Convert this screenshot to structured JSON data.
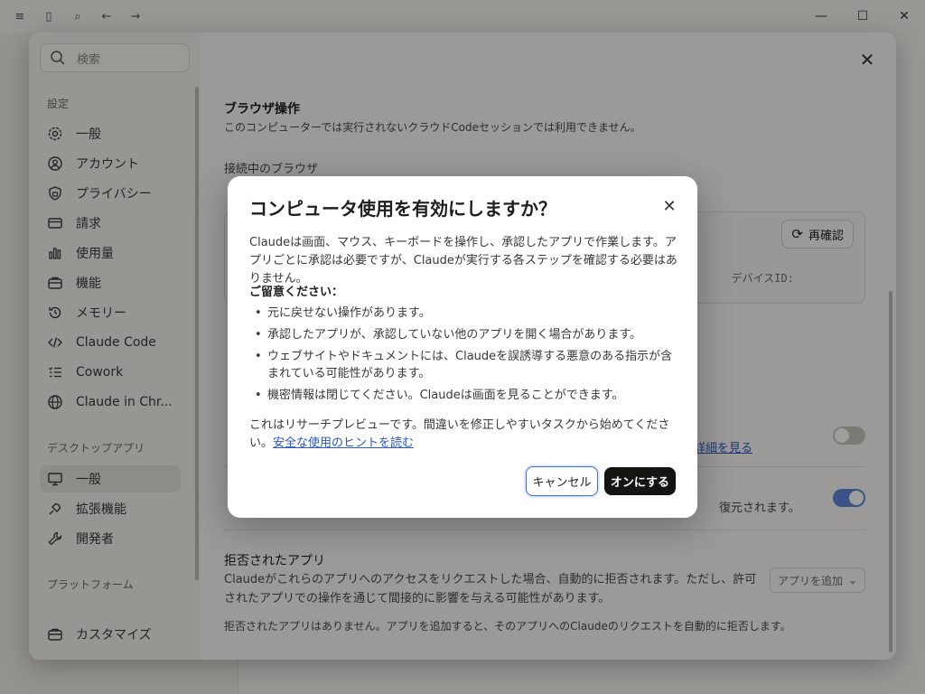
{
  "settings": {
    "search_placeholder": "検索",
    "nav_heading_settings": "設定",
    "nav_heading_desktop": "デスクトップアプリ",
    "nav_heading_platform": "プラットフォーム",
    "nav_items": [
      {
        "label": "一般",
        "icon": "gear-icon"
      },
      {
        "label": "アカウント",
        "icon": "user-circle-icon"
      },
      {
        "label": "プライバシー",
        "icon": "lock-shield-icon"
      },
      {
        "label": "請求",
        "icon": "card-icon"
      },
      {
        "label": "使用量",
        "icon": "bar-chart-icon"
      },
      {
        "label": "機能",
        "icon": "briefcase-icon"
      },
      {
        "label": "メモリー",
        "icon": "history-icon"
      },
      {
        "label": "Claude Code",
        "icon": "code-icon"
      },
      {
        "label": "Cowork",
        "icon": "checklist-icon"
      },
      {
        "label": "Claude in Chr...",
        "icon": "globe-icon"
      }
    ],
    "desktop_items": [
      {
        "label": "一般",
        "icon": "monitor-icon"
      },
      {
        "label": "拡張機能",
        "icon": "plug-icon"
      },
      {
        "label": "開発者",
        "icon": "wrench-icon"
      }
    ],
    "customize_label": "カスタマイズ",
    "browser_section_title": "ブラウザ操作",
    "browser_section_desc": "このコンピューターでは実行されないクラウドCodeセッションでは利用できません。",
    "connected_browser_title": "接続中のブラウザ",
    "recheck_label": "再確認",
    "device_id_label": "デバイスID:",
    "details_link": "詳細を見る",
    "restore_text": "復元されます。",
    "rejected_title": "拒否されたアプリ",
    "rejected_desc": "Claudeがこれらのアプリへのアクセスをリクエストした場合、自動的に拒否されます。ただし、許可されたアプリでの操作を通じて間接的に影響を与える可能性があります。",
    "add_app_label": "アプリを追加",
    "rejected_empty": "拒否されたアプリはありません。アプリを追加すると、そのアプリへのClaudeのリクエストを自動的に拒否します。"
  },
  "dialog": {
    "title": "コンピュータ使用を有効にしますか？",
    "intro": "Claudeは画面、マウス、キーボードを操作し、承認したアプリで作業します。アプリごとに承認は必要ですが、Claudeが実行する各ステップを確認する必要はありません。",
    "note_heading": "ご留意ください：",
    "bullets": [
      "元に戻せない操作があります。",
      "承認したアプリが、承認していない他のアプリを開く場合があります。",
      "ウェブサイトやドキュメントには、Claudeを誤誘導する悪意のある指示が含まれている可能性があります。",
      "機密情報は閉じてください。Claudeは画面を見ることができます。"
    ],
    "footer_text": "これはリサーチプレビューです。間違いを修正しやすいタスクから始めてください。",
    "footer_link": "安全な使用のヒントを読む",
    "cancel_label": "キャンセル",
    "confirm_label": "オンにする"
  },
  "colors": {
    "primary_button": "#141413",
    "link": "#2b59c3",
    "toggle_on": "#5b86d6",
    "toggle_off": "#c9c6bd"
  }
}
